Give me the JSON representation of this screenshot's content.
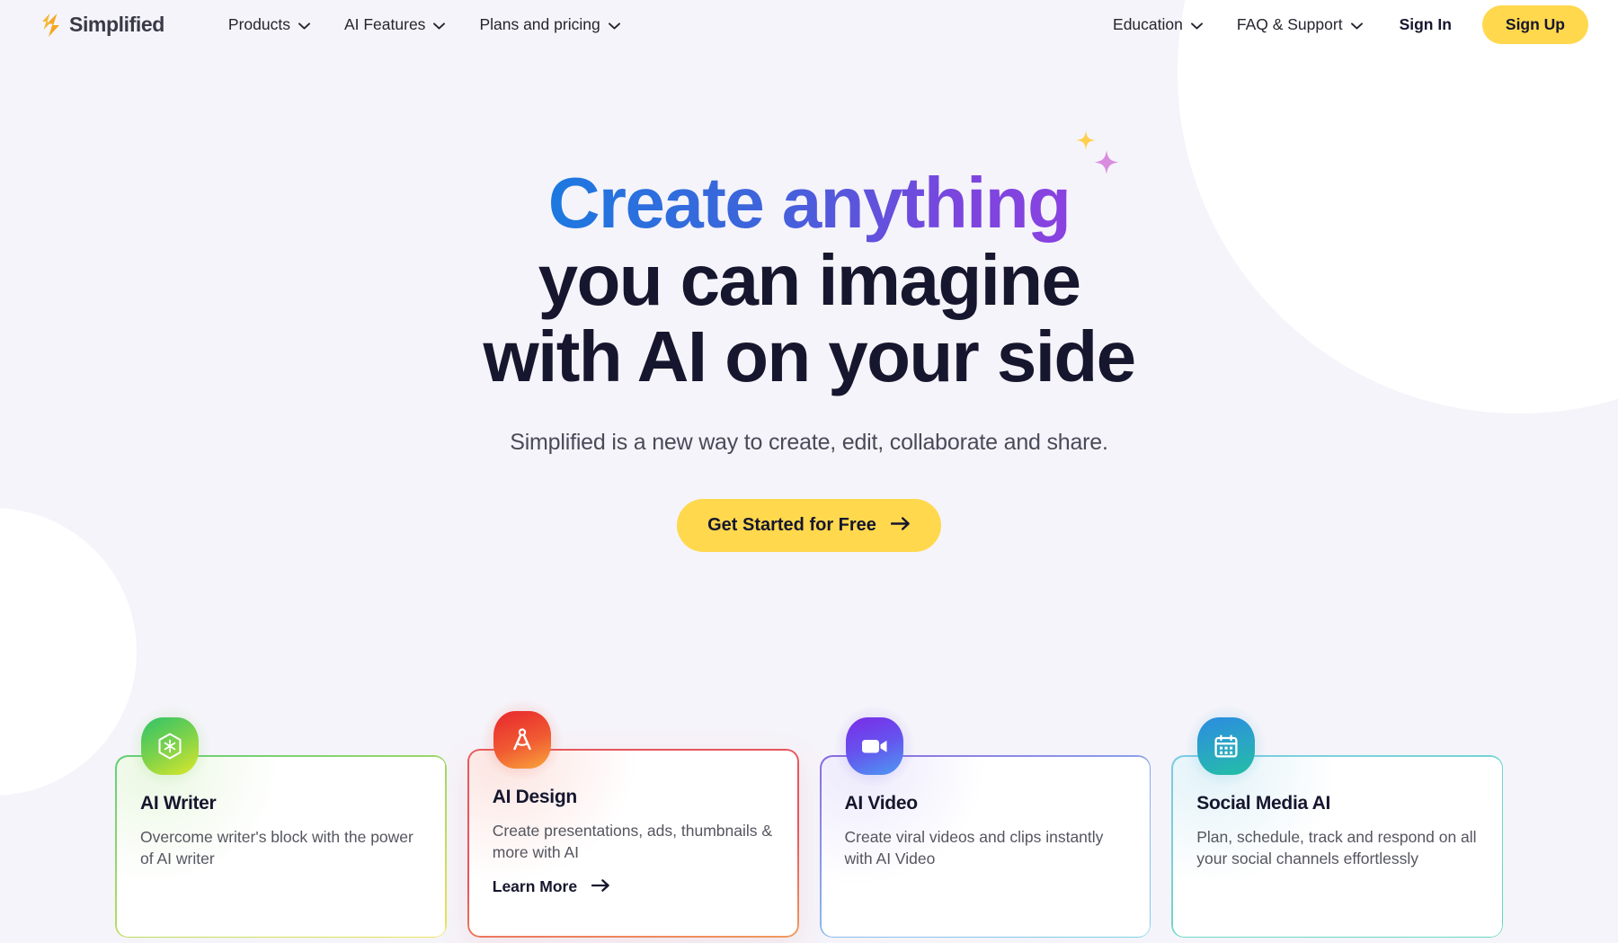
{
  "brand": {
    "name": "Simplified",
    "logo_icon": "simplified-bolt-logo",
    "logo_color": "#F5A623",
    "text_color": "#3A3A46"
  },
  "theme": {
    "page_background": "#F5F4FA",
    "accent_yellow": "#FFD84D",
    "heading_navy": "#16162E",
    "gradient_start": "#1C79E0",
    "gradient_end": "#8A42E0"
  },
  "nav": {
    "left_items": [
      {
        "label": "Products",
        "icon": "chevron-down-icon",
        "has_dropdown": true
      },
      {
        "label": "AI Features",
        "icon": "chevron-down-icon",
        "has_dropdown": true
      },
      {
        "label": "Plans and pricing",
        "icon": "chevron-down-icon",
        "has_dropdown": true
      }
    ],
    "right_items": [
      {
        "label": "Education",
        "icon": "chevron-down-icon",
        "has_dropdown": true
      },
      {
        "label": "FAQ & Support",
        "icon": "chevron-down-icon",
        "has_dropdown": true
      }
    ],
    "sign_in_label": "Sign In",
    "sign_up_label": "Sign Up"
  },
  "hero": {
    "headline_line1_gradient": "Create anything",
    "headline_line2": "you can imagine",
    "headline_line3": "with AI on your side",
    "sparkle_icons": [
      "sparkle-yellow-icon",
      "sparkle-pink-icon"
    ],
    "subtitle": "Simplified is a new way to create, edit, collaborate and share.",
    "cta_label": "Get Started for Free",
    "cta_icon": "arrow-right-icon"
  },
  "cards": [
    {
      "title": "AI Writer",
      "description": "Overcome writer's block with the power of AI writer",
      "icon": "hexagon-sparkle-icon",
      "icon_gradient_from": "#2FC36A",
      "icon_gradient_to": "#DDE82A",
      "border_gradient_from": "#5ECB7E",
      "border_gradient_to": "#EFE45C",
      "active": false,
      "link_label": null
    },
    {
      "title": "AI Design",
      "description": "Create presentations, ads, thumbnails & more with AI",
      "icon": "compass-drafting-icon",
      "icon_gradient_from": "#E8262D",
      "icon_gradient_to": "#F9A73C",
      "border_gradient_from": "#E8555C",
      "border_gradient_to": "#F09A5E",
      "active": true,
      "link_label": "Learn More",
      "link_icon": "arrow-right-icon"
    },
    {
      "title": "AI Video",
      "description": "Create viral videos and clips instantly with AI Video",
      "icon": "video-camera-icon",
      "icon_gradient_from": "#7B2BE8",
      "icon_gradient_to": "#4D9BF2",
      "border_gradient_from": "#8A6BE0",
      "border_gradient_to": "#7FD3E8",
      "active": false,
      "link_label": null
    },
    {
      "title": "Social Media AI",
      "description": "Plan, schedule, track and respond on all your social channels effortlessly",
      "icon": "calendar-icon",
      "icon_gradient_from": "#2B8CE0",
      "icon_gradient_to": "#23BFA5",
      "border_gradient_from": "#84CFE8",
      "border_gradient_to": "#63D8BC",
      "active": false,
      "link_label": null
    }
  ]
}
